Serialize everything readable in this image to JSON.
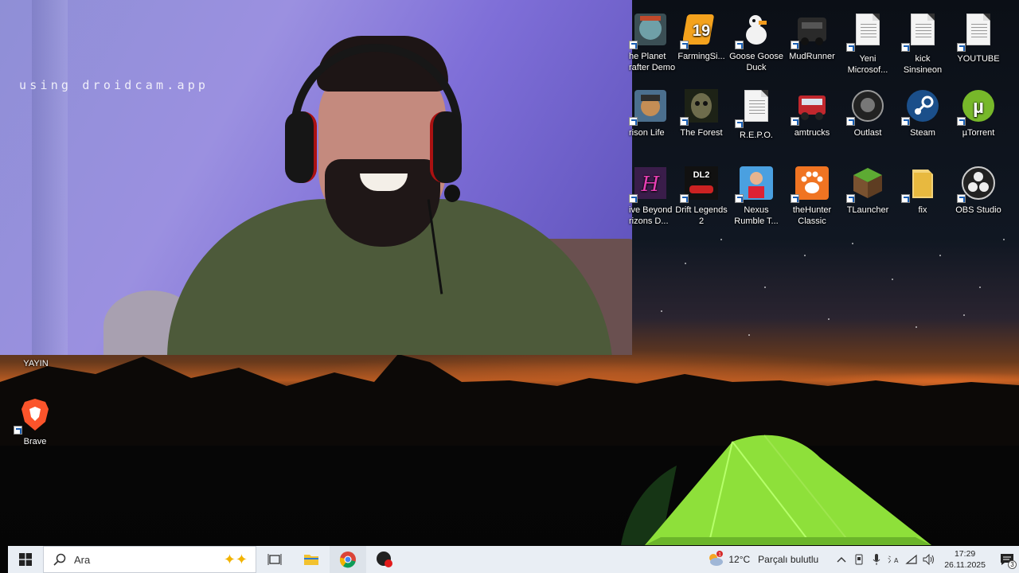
{
  "webcam": {
    "watermark": "using droidcam.app"
  },
  "desktop": {
    "icons_right": [
      {
        "name": "the-planet-crafter-demo",
        "label": "he Planet\nrafter Demo",
        "icon": "planet-crafter-icon"
      },
      {
        "name": "farming-simulator",
        "label": "FarmingSi...",
        "icon": "farming-simulator-19-icon"
      },
      {
        "name": "goose-goose-duck",
        "label": "Goose Goose\nDuck",
        "icon": "goose-icon"
      },
      {
        "name": "mudrunner",
        "label": "MudRunner",
        "icon": "truck-icon"
      },
      {
        "name": "yeni-microsoft",
        "label": "Yeni\nMicrosof...",
        "icon": "document-icon"
      },
      {
        "name": "kick-sinsineon",
        "label": "kick\nSinsineon",
        "icon": "document-icon"
      },
      {
        "name": "youtube-file",
        "label": "YOUTUBE",
        "icon": "document-icon"
      },
      {
        "name": "prison-life",
        "label": "rison Life",
        "icon": "prison-life-icon"
      },
      {
        "name": "the-forest",
        "label": "The Forest",
        "icon": "forest-mask-icon"
      },
      {
        "name": "repo-file",
        "label": "R.E.P.O.",
        "icon": "document-icon"
      },
      {
        "name": "amtrucks",
        "label": "amtrucks",
        "icon": "american-truck-icon"
      },
      {
        "name": "outlast",
        "label": "Outlast",
        "icon": "outlast-icon"
      },
      {
        "name": "steam",
        "label": "Steam",
        "icon": "steam-icon"
      },
      {
        "name": "utorrent",
        "label": "µTorrent",
        "icon": "utorrent-icon"
      },
      {
        "name": "drive-beyond-horizons",
        "label": "ive Beyond\nrizons D...",
        "icon": "drive-beyond-icon"
      },
      {
        "name": "drift-legends-2",
        "label": "Drift Legends\n2",
        "icon": "drift-legends-icon"
      },
      {
        "name": "nexus-rumble",
        "label": "Nexus\nRumble T...",
        "icon": "nexus-rumble-icon"
      },
      {
        "name": "thehunter-classic",
        "label": "theHunter\nClassic",
        "icon": "paw-icon"
      },
      {
        "name": "tlauncher",
        "label": "TLauncher",
        "icon": "grass-block-icon"
      },
      {
        "name": "fix-folder",
        "label": "fix",
        "icon": "folder-icon"
      },
      {
        "name": "obs-studio",
        "label": "OBS Studio",
        "icon": "obs-icon"
      }
    ],
    "icons_left": [
      {
        "name": "yayin",
        "label": "YAYIN"
      },
      {
        "name": "brave",
        "label": "Brave",
        "icon": "brave-lion-icon"
      }
    ]
  },
  "taskbar": {
    "search_placeholder": "Ara",
    "weather": {
      "temp": "12°C",
      "condition": "Parçalı bulutlu",
      "alert_count": "1"
    },
    "clock": {
      "time": "17:29",
      "date": "26.11.2025"
    },
    "notification_count": "3",
    "apps": [
      "task-view",
      "file-explorer",
      "chrome",
      "recorder"
    ]
  },
  "colors": {
    "taskbar_bg": "#e9eef4",
    "tent_green": "#8ee03a",
    "sky_orange": "#b55a22"
  }
}
